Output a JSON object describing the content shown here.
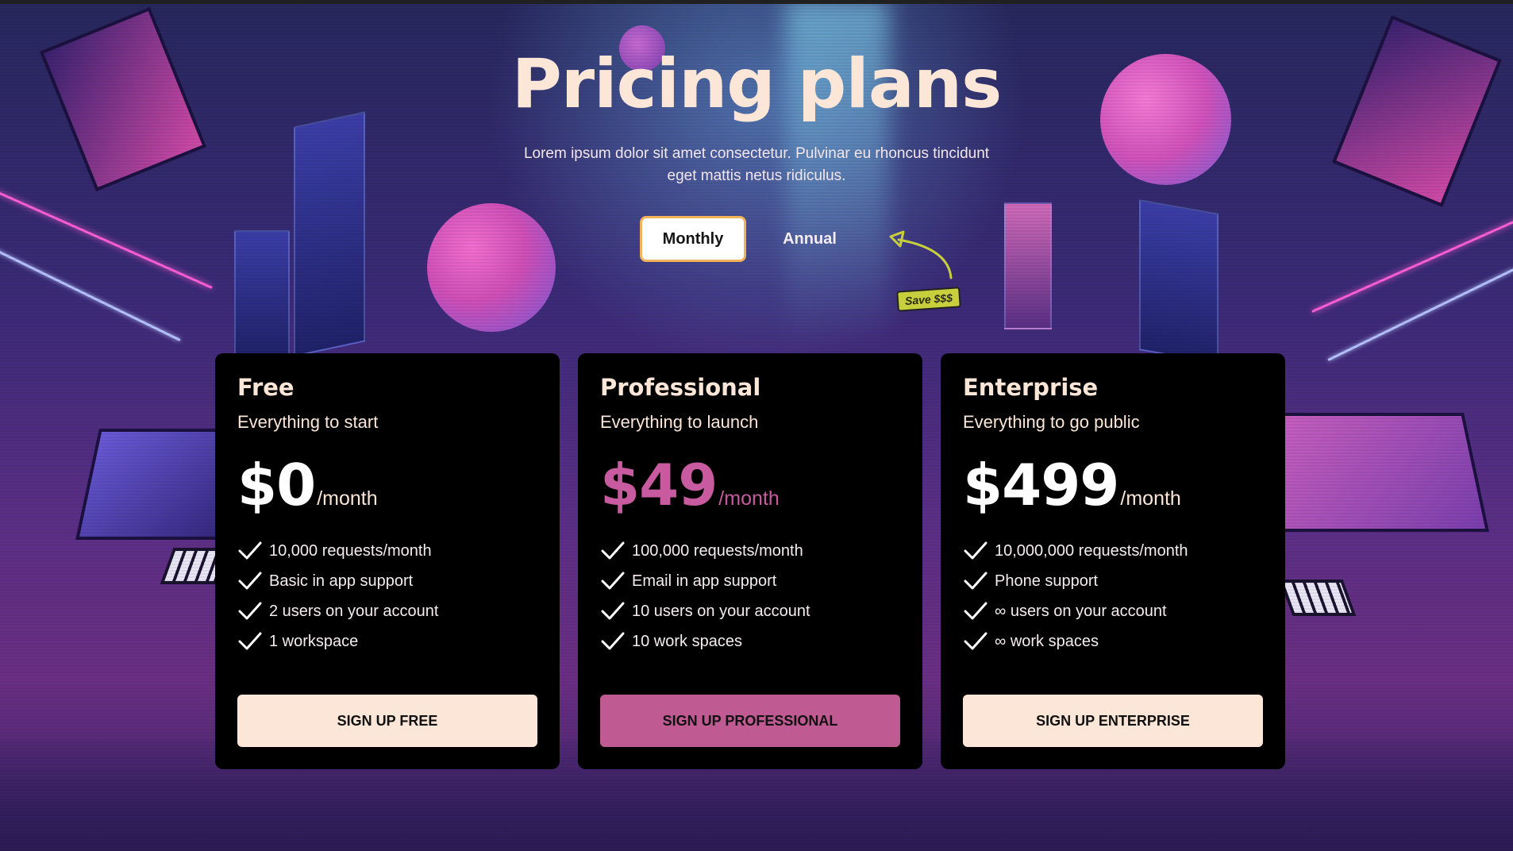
{
  "header": {
    "title": "Pricing plans",
    "subtitle": "Lorem ipsum dolor sit amet consectetur. Pulvinar eu rhoncus tincidunt eget mattis netus ridiculus."
  },
  "billing_toggle": {
    "monthly_label": "Monthly",
    "annual_label": "Annual",
    "selected": "Monthly",
    "save_badge": "Save $$$"
  },
  "colors": {
    "accent_pink": "#c85ba0",
    "button_cream": "#fbe6d8",
    "toggle_border": "#f2b25b",
    "badge_yellow": "#c8cf3d"
  },
  "plans": [
    {
      "name": "Free",
      "tagline": "Everything to start",
      "price": "$0",
      "period": "/month",
      "features": [
        "10,000 requests/month",
        "Basic in app support",
        "2 users on your account",
        "1 workspace"
      ],
      "cta": "SIGN UP FREE"
    },
    {
      "name": "Professional",
      "tagline": "Everything to launch",
      "price": "$49",
      "period": "/month",
      "features": [
        "100,000 requests/month",
        "Email in app support",
        "10 users on your account",
        "10 work spaces"
      ],
      "cta": "SIGN UP PROFESSIONAL"
    },
    {
      "name": "Enterprise",
      "tagline": "Everything to go public",
      "price": "$499",
      "period": "/month",
      "features": [
        "10,000,000 requests/month",
        "Phone support",
        "∞ users on your account",
        "∞ work spaces"
      ],
      "cta": "SIGN UP ENTERPRISE"
    }
  ],
  "icons": {
    "feature_check": "check-icon",
    "save_arrow": "curved-arrow-icon"
  }
}
